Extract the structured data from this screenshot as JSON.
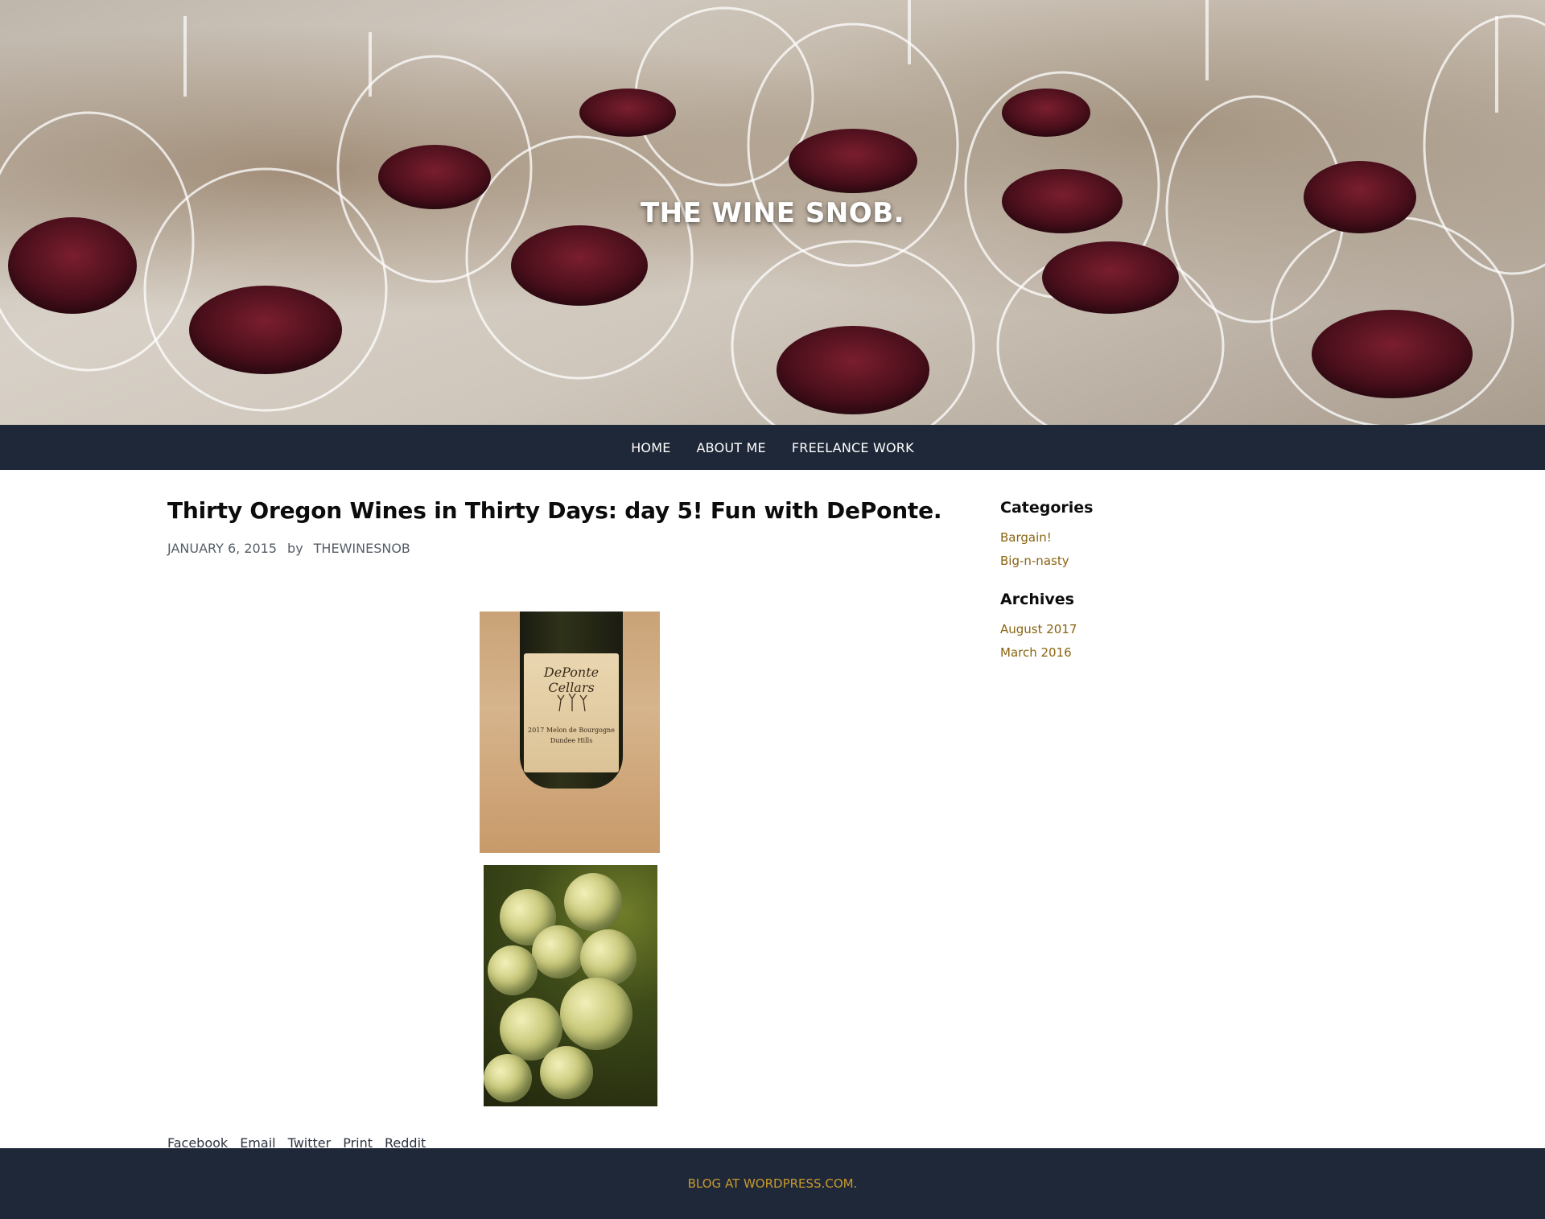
{
  "site": {
    "title": "THE WINE SNOB."
  },
  "nav": {
    "items": [
      {
        "label": "HOME"
      },
      {
        "label": "ABOUT ME"
      },
      {
        "label": "FREELANCE WORK"
      }
    ]
  },
  "post": {
    "title": "Thirty Oregon Wines in Thirty Days: day 5! Fun with DePonte.",
    "date": "JANUARY 6, 2015",
    "by": "by",
    "author": "THEWINESNOB",
    "bottle_label": {
      "brand": "DePonte Cellars",
      "line1": "2017 Melon de Bourgogne",
      "line2": "Dundee Hills"
    }
  },
  "share": {
    "items": [
      {
        "label": "Facebook"
      },
      {
        "label": "Email"
      },
      {
        "label": "Twitter"
      },
      {
        "label": "Print"
      },
      {
        "label": "Reddit"
      }
    ]
  },
  "sidebar": {
    "categories": {
      "title": "Categories",
      "items": [
        {
          "label": "Bargain!"
        },
        {
          "label": "Big-n-nasty"
        }
      ]
    },
    "archives": {
      "title": "Archives",
      "items": [
        {
          "label": "August 2017"
        },
        {
          "label": "March 2016"
        }
      ]
    }
  },
  "footer": {
    "link": "BLOG AT WORDPRESS.COM."
  },
  "colors": {
    "nav_bg": "#1f2838",
    "link": "#8a6410",
    "footer_link": "#c99a2e"
  }
}
